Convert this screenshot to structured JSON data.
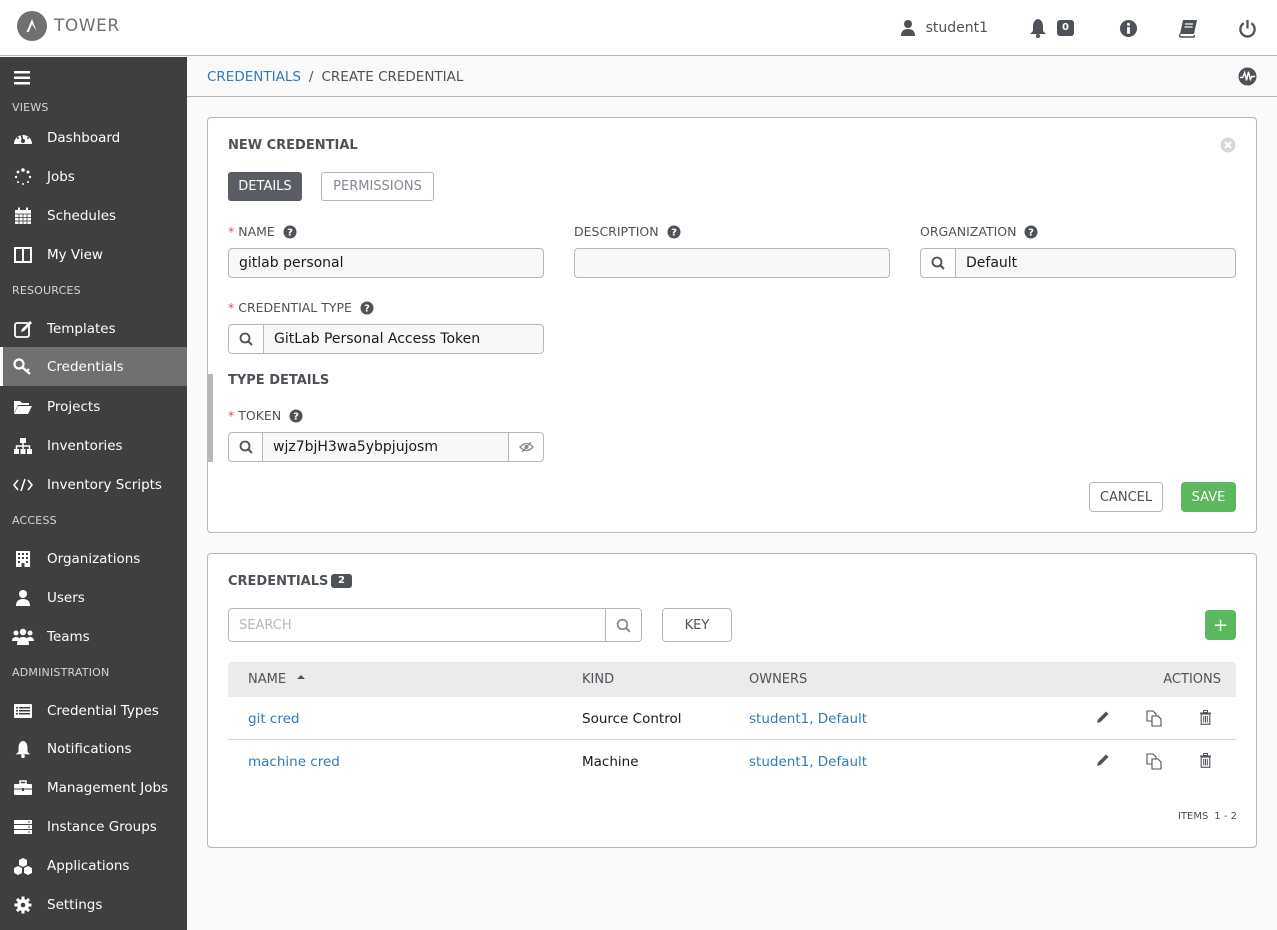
{
  "app": {
    "brand": "TOWER"
  },
  "header": {
    "username": "student1",
    "notifications_count": "0",
    "icons": [
      "user-icon",
      "bell-icon",
      "info-icon",
      "book-icon",
      "power-icon"
    ]
  },
  "sidebar": {
    "sections": [
      {
        "label": "VIEWS",
        "items": [
          {
            "label": "Dashboard",
            "icon": "dashboard-icon"
          },
          {
            "label": "Jobs",
            "icon": "jobs-spinner-icon"
          },
          {
            "label": "Schedules",
            "icon": "calendar-icon"
          },
          {
            "label": "My View",
            "icon": "columns-icon"
          }
        ]
      },
      {
        "label": "RESOURCES",
        "items": [
          {
            "label": "Templates",
            "icon": "edit-icon"
          },
          {
            "label": "Credentials",
            "icon": "key-icon",
            "active": true
          },
          {
            "label": "Projects",
            "icon": "folder-open-icon"
          },
          {
            "label": "Inventories",
            "icon": "sitemap-icon"
          },
          {
            "label": "Inventory Scripts",
            "icon": "code-icon"
          }
        ]
      },
      {
        "label": "ACCESS",
        "items": [
          {
            "label": "Organizations",
            "icon": "building-icon"
          },
          {
            "label": "Users",
            "icon": "user-icon"
          },
          {
            "label": "Teams",
            "icon": "users-icon"
          }
        ]
      },
      {
        "label": "ADMINISTRATION",
        "items": [
          {
            "label": "Credential Types",
            "icon": "list-alt-icon"
          },
          {
            "label": "Notifications",
            "icon": "bell-icon"
          },
          {
            "label": "Management Jobs",
            "icon": "briefcase-icon"
          },
          {
            "label": "Instance Groups",
            "icon": "server-icon"
          },
          {
            "label": "Applications",
            "icon": "cubes-icon"
          },
          {
            "label": "Settings",
            "icon": "cog-icon"
          }
        ]
      }
    ]
  },
  "breadcrumb": {
    "parent": "CREDENTIALS",
    "separator": "/",
    "current": "CREATE CREDENTIAL"
  },
  "form": {
    "title": "NEW CREDENTIAL",
    "tabs": {
      "details": "DETAILS",
      "permissions": "PERMISSIONS"
    },
    "fields": {
      "name": {
        "label": "NAME",
        "value": "gitlab personal",
        "required": "*"
      },
      "description": {
        "label": "DESCRIPTION",
        "value": ""
      },
      "organization": {
        "label": "ORGANIZATION",
        "value": "Default"
      },
      "credential_type": {
        "label": "CREDENTIAL TYPE",
        "value": "GitLab Personal Access Token",
        "required": "*"
      }
    },
    "type_details": {
      "title": "TYPE DETAILS",
      "token": {
        "label": "TOKEN",
        "value": "wjz7bjH3wa5ybpjujosm",
        "required": "*"
      }
    },
    "buttons": {
      "cancel": "CANCEL",
      "save": "SAVE"
    }
  },
  "list": {
    "title": "CREDENTIALS",
    "count": "2",
    "search_placeholder": "SEARCH",
    "key_label": "KEY",
    "add_label": "+",
    "columns": {
      "name": "NAME",
      "kind": "KIND",
      "owners": "OWNERS",
      "actions": "ACTIONS"
    },
    "rows": [
      {
        "name": "git cred",
        "kind": "Source Control",
        "owners": "student1, Default"
      },
      {
        "name": "machine cred",
        "kind": "Machine",
        "owners": "student1, Default"
      }
    ],
    "items_label": "ITEMS",
    "items_range": "1 - 2"
  },
  "colors": {
    "accent_link": "#337ab7",
    "success": "#5cb85c",
    "sidebar": "#3f3f3f",
    "required": "#d9534f"
  }
}
